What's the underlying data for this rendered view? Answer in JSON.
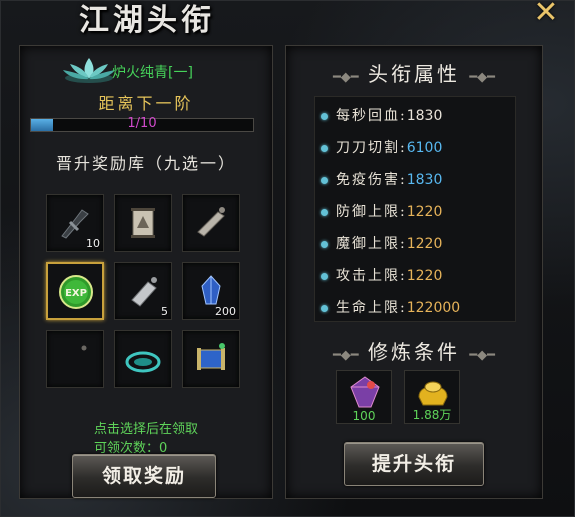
{
  "window": {
    "title": "江湖头衔",
    "close_icon": "close-icon"
  },
  "rank": {
    "name": "炉火纯青[一]",
    "next_label": "距离下一阶",
    "progress_text": "1/10",
    "progress_fraction": 0.1
  },
  "rewards": {
    "title": "晋升奖励库（九选一）",
    "items": [
      {
        "icon": "dark-weapon-icon",
        "count": "10"
      },
      {
        "icon": "scroll-painting-icon",
        "count": ""
      },
      {
        "icon": "bone-shard-icon",
        "count": ""
      },
      {
        "icon": "exp-orb-icon",
        "count": "",
        "selected": true
      },
      {
        "icon": "silver-ingot-icon",
        "count": "5"
      },
      {
        "icon": "blue-gem-figure-icon",
        "count": "200"
      },
      {
        "icon": "empty-slot",
        "count": ""
      },
      {
        "icon": "jade-disc-icon",
        "count": ""
      },
      {
        "icon": "blue-scroll-icon",
        "count": ""
      }
    ],
    "hint": "点击选择后在领取",
    "claims_label": "可领次数：",
    "claims_value": "0",
    "claim_button": "领取奖励"
  },
  "attributes": {
    "title": "头衔属性",
    "rows": [
      {
        "label": "每秒回血",
        "value": "1830",
        "color": "#e9e4da"
      },
      {
        "label": "刀刀切割",
        "value": "6100",
        "color": "#58b8f0"
      },
      {
        "label": "免疫伤害",
        "value": "1830",
        "color": "#58b8f0"
      },
      {
        "label": "防御上限",
        "value": "1220",
        "color": "#e6b35a"
      },
      {
        "label": "魔御上限",
        "value": "1220",
        "color": "#e6b35a"
      },
      {
        "label": "攻击上限",
        "value": "1220",
        "color": "#e6b35a"
      },
      {
        "label": "生命上限",
        "value": "122000",
        "color": "#e6b35a"
      }
    ]
  },
  "conditions": {
    "title": "修炼条件",
    "items": [
      {
        "icon": "gem-stone-icon",
        "amount": "100"
      },
      {
        "icon": "gold-ingot-icon",
        "amount": "1.88万"
      }
    ],
    "upgrade_button": "提升头衔"
  },
  "colors": {
    "accent_green": "#46d25a",
    "accent_gold": "#e6c45a",
    "progress_text": "#d04acb"
  }
}
